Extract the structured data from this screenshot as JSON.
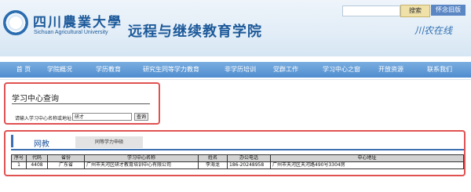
{
  "header": {
    "logo_cn": "四川農業大學",
    "logo_en": "Sichuan Agricultural University",
    "site_title": "远程与继续教育学院",
    "search_label": "搜索",
    "old_version_label": "怀念旧版",
    "brand_mark": "川农在线"
  },
  "nav": {
    "items": [
      {
        "label": "首 页"
      },
      {
        "label": "学院概况"
      },
      {
        "label": "学历教育"
      },
      {
        "label": "研究生同等学力教育"
      },
      {
        "label": "非学历培训"
      },
      {
        "label": "党群工作"
      },
      {
        "label": "学习中心之窗"
      },
      {
        "label": "开放资源"
      },
      {
        "label": "联系我们"
      }
    ]
  },
  "query": {
    "title": "学习中心查询",
    "label": "请输入学习中心名称或地址:",
    "input_value": "研才",
    "button_label": "查询"
  },
  "results": {
    "tab_active": "网教",
    "tab_inactive": "同等学力申硕",
    "columns": [
      "序号",
      "代码",
      "省份",
      "学习中心名称",
      "姓名",
      "办公电话",
      "中心地址"
    ],
    "rows": [
      [
        "1",
        "4408",
        "广东省",
        "广州市天河区研才教育培训中心有限公司",
        "李海龙",
        "186-20248958",
        "广州市天河区天河路490号3304房"
      ]
    ]
  },
  "colors": {
    "nav": "#5b95d4",
    "title": "#1d5a9a",
    "highlight": "#e05151"
  }
}
